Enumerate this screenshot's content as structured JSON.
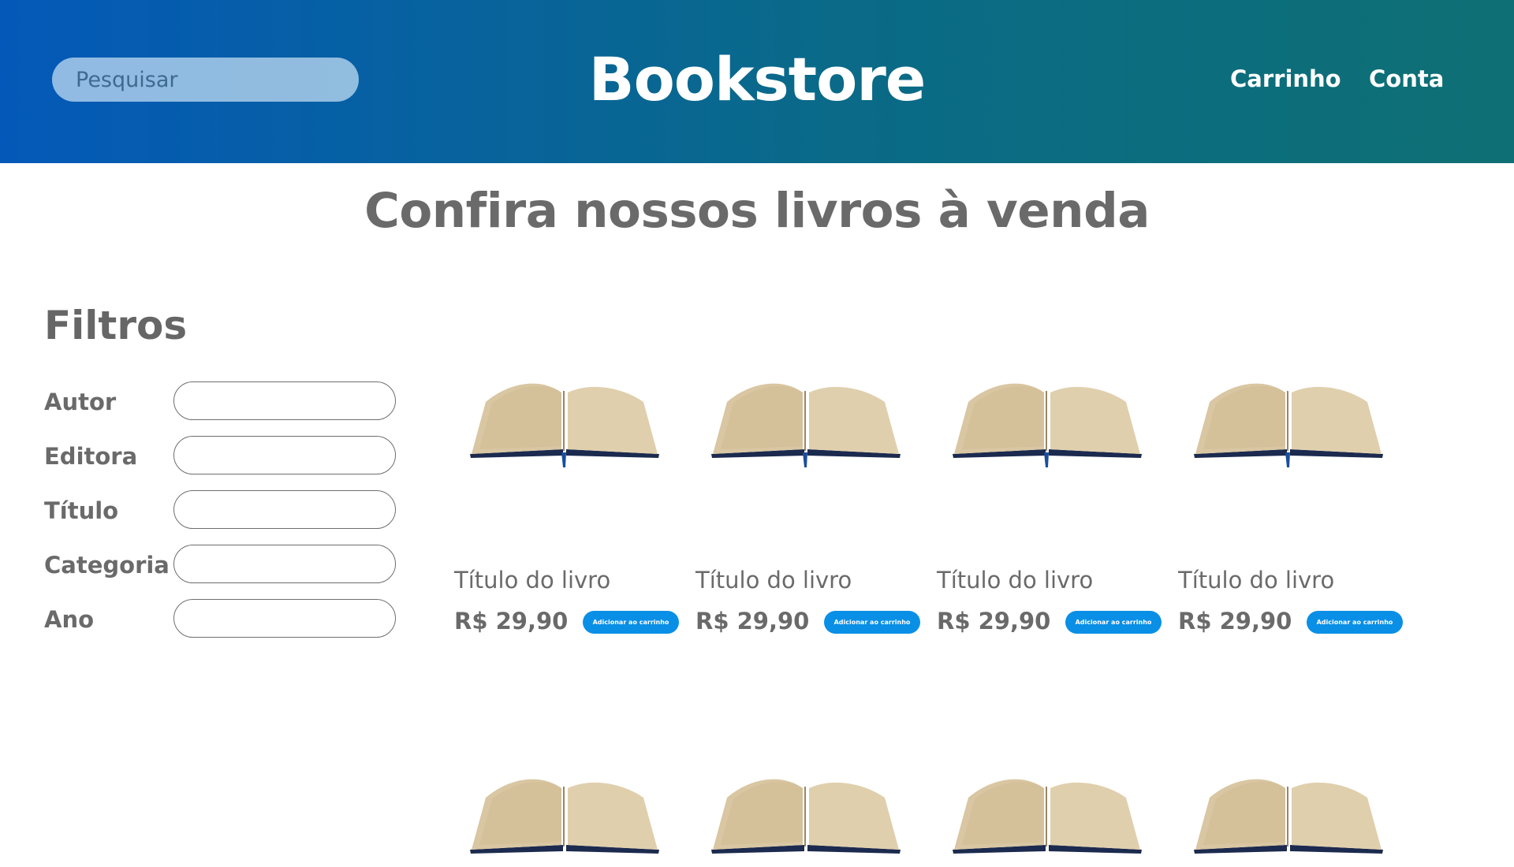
{
  "header": {
    "search_placeholder": "Pesquisar",
    "brand": "Bookstore",
    "nav": {
      "cart": "Carrinho",
      "account": "Conta"
    }
  },
  "main": {
    "title": "Confira nossos livros à venda"
  },
  "filters": {
    "title": "Filtros",
    "fields": [
      {
        "label": "Autor"
      },
      {
        "label": "Editora"
      },
      {
        "label": "Título"
      },
      {
        "label": "Categoria"
      },
      {
        "label": "Ano"
      }
    ]
  },
  "products": [
    {
      "title": "Título do livro",
      "price": "R$ 29,90",
      "button": "Adicionar ao carrinho"
    },
    {
      "title": "Título do livro",
      "price": "R$ 29,90",
      "button": "Adicionar ao carrinho"
    },
    {
      "title": "Título do livro",
      "price": "R$ 29,90",
      "button": "Adicionar ao carrinho"
    },
    {
      "title": "Título do livro",
      "price": "R$ 29,90",
      "button": "Adicionar ao carrinho"
    },
    {
      "title": "",
      "price": "",
      "button": ""
    },
    {
      "title": "",
      "price": "",
      "button": ""
    },
    {
      "title": "",
      "price": "",
      "button": ""
    },
    {
      "title": "",
      "price": "",
      "button": ""
    }
  ],
  "colors": {
    "header_start": "#0459b8",
    "header_end": "#0e7074",
    "button": "#0a8fe6",
    "text": "#666666"
  }
}
